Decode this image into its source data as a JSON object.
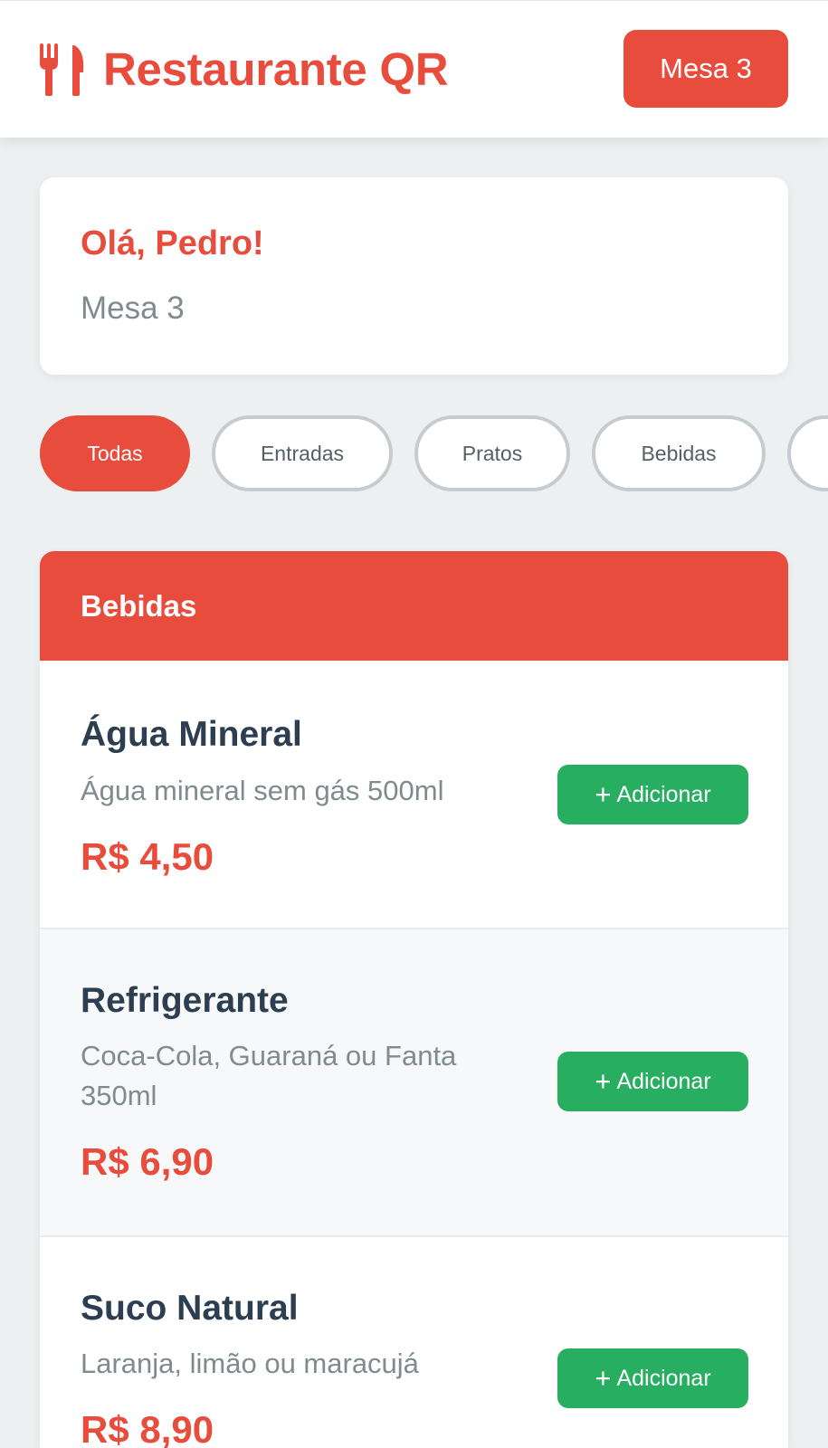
{
  "header": {
    "icon": "utensils-icon",
    "title": "Restaurante QR",
    "table_button": "Mesa 3"
  },
  "welcome": {
    "greeting": "Olá, Pedro!",
    "table": "Mesa 3"
  },
  "categories": [
    {
      "label": "Todas",
      "active": true
    },
    {
      "label": "Entradas",
      "active": false
    },
    {
      "label": "Pratos",
      "active": false
    },
    {
      "label": "Bebidas",
      "active": false
    }
  ],
  "section": {
    "title": "Bebidas",
    "items": [
      {
        "name": "Água Mineral",
        "description": "Água mineral sem gás 500ml",
        "price": "R$ 4,50",
        "add_label": "Adicionar"
      },
      {
        "name": "Refrigerante",
        "description": "Coca-Cola, Guaraná ou Fanta 350ml",
        "price": "R$ 6,90",
        "add_label": "Adicionar"
      },
      {
        "name": "Suco Natural",
        "description": "Laranja, limão ou maracujá",
        "price": "R$ 8,90",
        "add_label": "Adicionar"
      }
    ]
  },
  "colors": {
    "accent": "#e74c3c",
    "add_button": "#27ae60",
    "background": "#ecf0f1",
    "heading_text": "#2c3e50",
    "muted_text": "#7f8c8d"
  }
}
